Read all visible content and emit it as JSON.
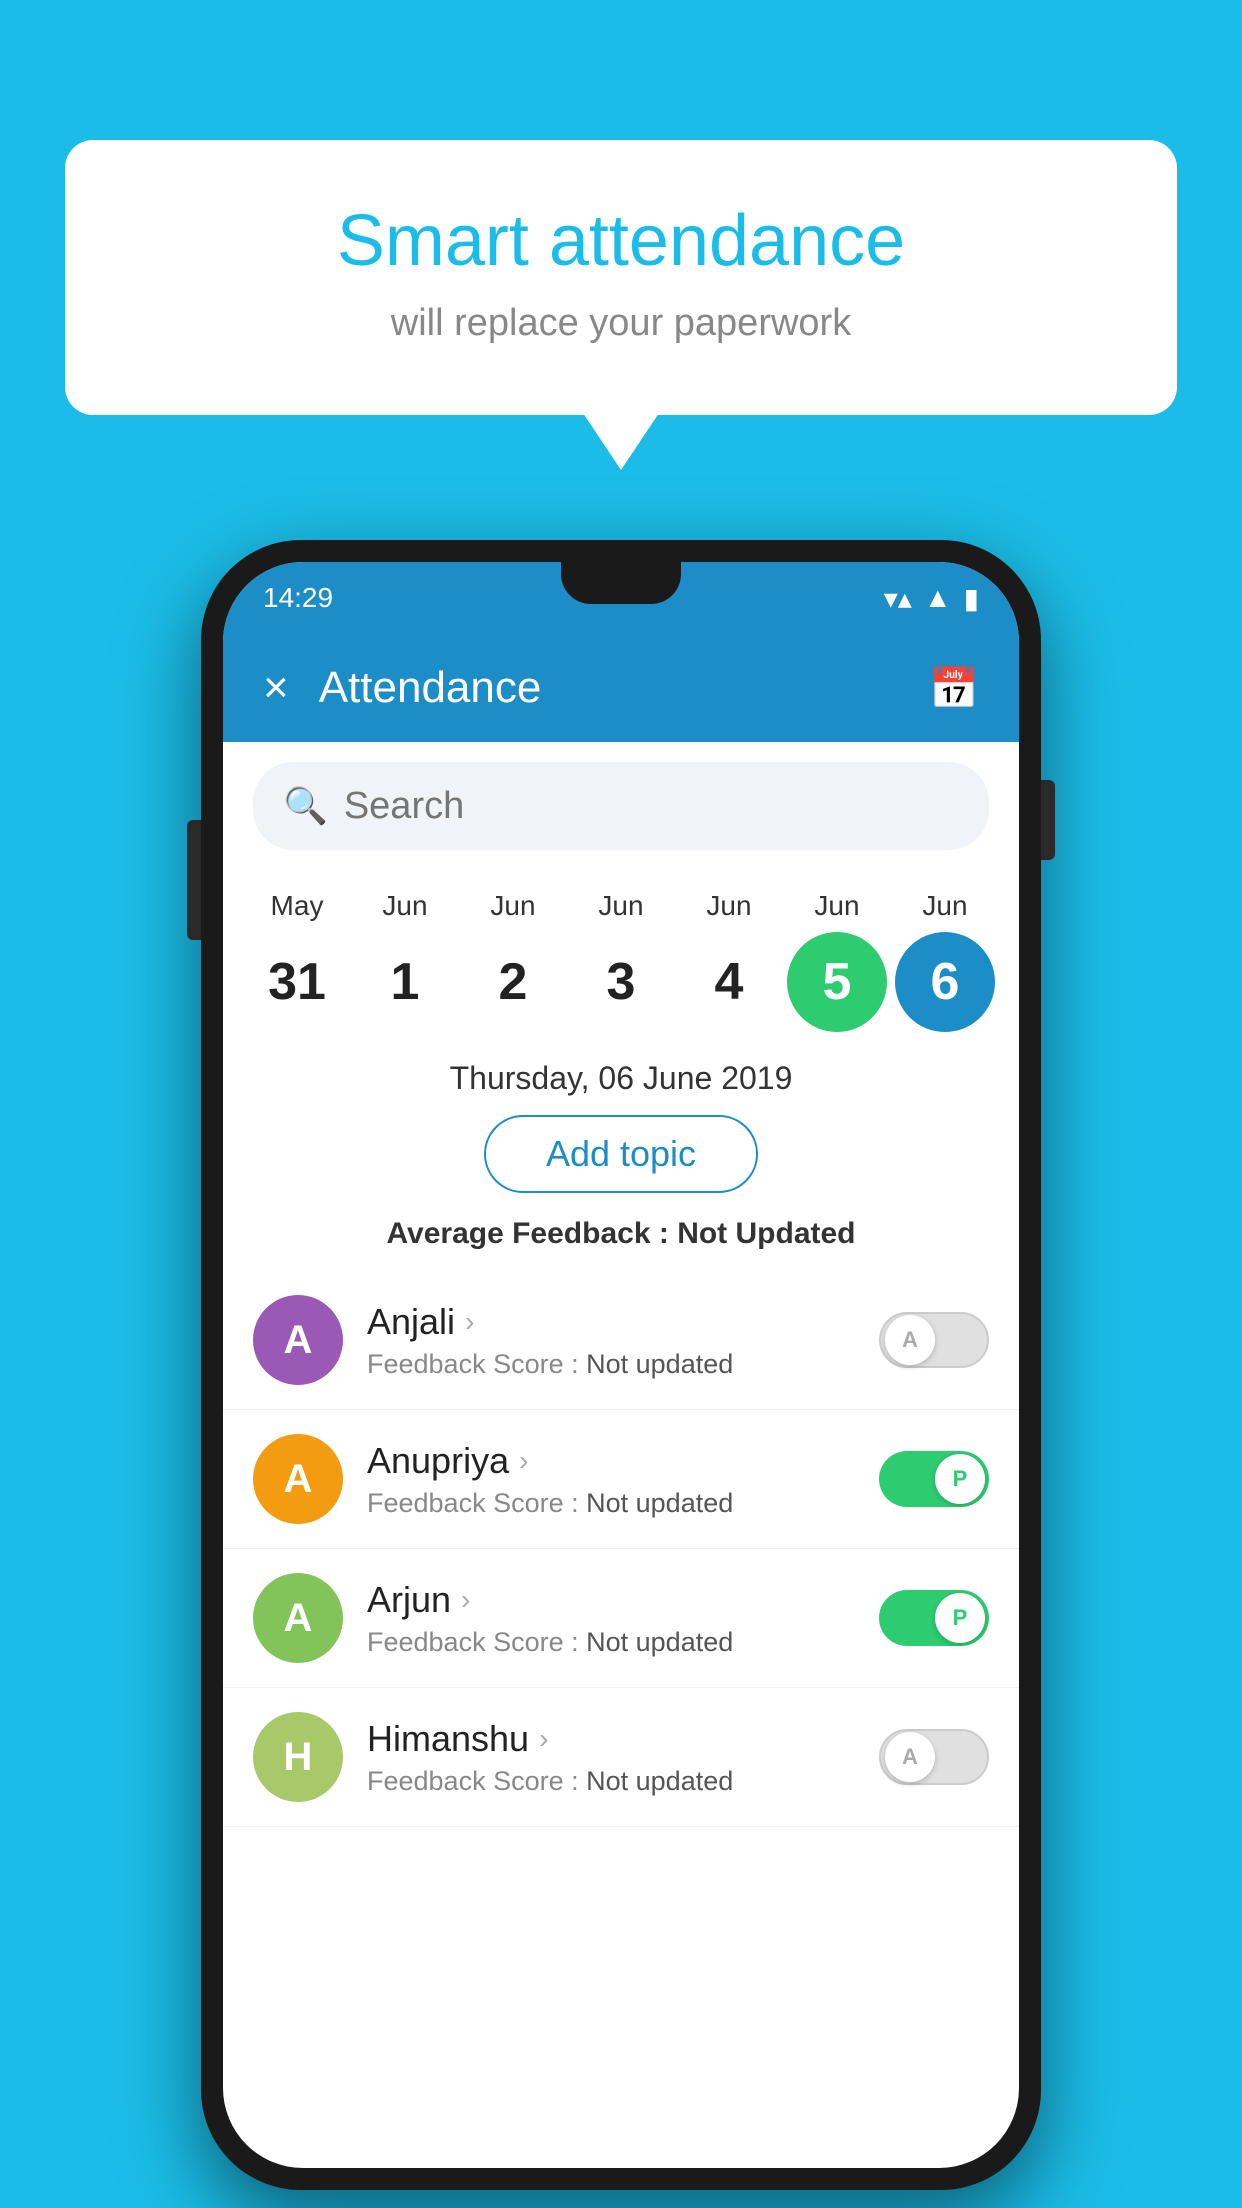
{
  "background_color": "#1BBDE8",
  "bubble": {
    "title": "Smart attendance",
    "subtitle": "will replace your paperwork"
  },
  "status_bar": {
    "time": "14:29",
    "wifi": "▼▲",
    "battery": "▮"
  },
  "app_bar": {
    "title": "Attendance",
    "close_label": "×",
    "calendar_icon": "📅"
  },
  "search": {
    "placeholder": "Search"
  },
  "dates": [
    {
      "month": "May",
      "day": "31",
      "state": "normal"
    },
    {
      "month": "Jun",
      "day": "1",
      "state": "normal"
    },
    {
      "month": "Jun",
      "day": "2",
      "state": "normal"
    },
    {
      "month": "Jun",
      "day": "3",
      "state": "normal"
    },
    {
      "month": "Jun",
      "day": "4",
      "state": "normal"
    },
    {
      "month": "Jun",
      "day": "5",
      "state": "today"
    },
    {
      "month": "Jun",
      "day": "6",
      "state": "selected"
    }
  ],
  "selected_date": "Thursday, 06 June 2019",
  "add_topic_label": "Add topic",
  "avg_feedback_label": "Average Feedback :",
  "avg_feedback_value": "Not Updated",
  "students": [
    {
      "name": "Anjali",
      "avatar_letter": "A",
      "avatar_color": "#9B59B6",
      "feedback_label": "Feedback Score :",
      "feedback_value": "Not updated",
      "toggle_state": "off",
      "toggle_label": "A"
    },
    {
      "name": "Anupriya",
      "avatar_letter": "A",
      "avatar_color": "#F39C12",
      "feedback_label": "Feedback Score :",
      "feedback_value": "Not updated",
      "toggle_state": "on",
      "toggle_label": "P"
    },
    {
      "name": "Arjun",
      "avatar_letter": "A",
      "avatar_color": "#82C45A",
      "feedback_label": "Feedback Score :",
      "feedback_value": "Not updated",
      "toggle_state": "on",
      "toggle_label": "P"
    },
    {
      "name": "Himanshu",
      "avatar_letter": "H",
      "avatar_color": "#A8C86A",
      "feedback_label": "Feedback Score :",
      "feedback_value": "Not updated",
      "toggle_state": "off",
      "toggle_label": "A"
    }
  ]
}
